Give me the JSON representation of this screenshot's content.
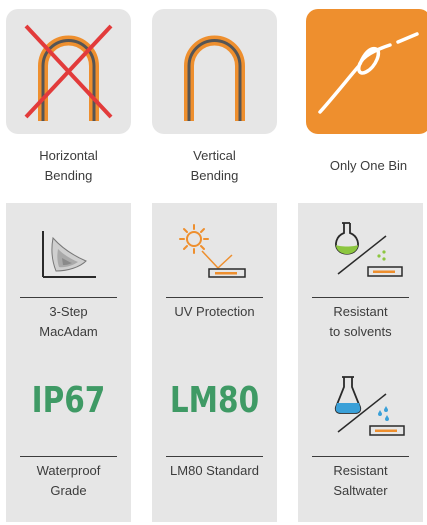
{
  "colors": {
    "orange": "#ee8f2e",
    "tile_gray": "#e6e6e6",
    "green": "#3f9a65",
    "red": "#e23b3b",
    "dark": "#3c3c3c"
  },
  "items": [
    {
      "id": "horizontal-bending",
      "icon": "crossed-arch-icon",
      "label": "Horizontal\nBending"
    },
    {
      "id": "vertical-bending",
      "icon": "arch-icon",
      "label": "Vertical\nBending"
    },
    {
      "id": "only-one-bin",
      "icon": "bin-curve-icon",
      "label": "Only One Bin"
    },
    {
      "id": "macadam",
      "icon": "macadam-chart-icon",
      "label": "3-Step\nMacAdam"
    },
    {
      "id": "uv-protection",
      "icon": "sun-uv-icon",
      "label": "UV Protection"
    },
    {
      "id": "resistant-solvents",
      "icon": "flask-solvent-icon",
      "label": "Resistant\nto solvents"
    },
    {
      "id": "waterproof",
      "icon": "ip67-badge",
      "badge": "IP67",
      "label": "Waterproof\nGrade"
    },
    {
      "id": "lm80",
      "icon": "lm80-badge",
      "badge": "LM80",
      "label": "LM80 Standard"
    },
    {
      "id": "resistant-saltwater",
      "icon": "beaker-saltwater-icon",
      "label": "Resistant\nSaltwater"
    }
  ]
}
